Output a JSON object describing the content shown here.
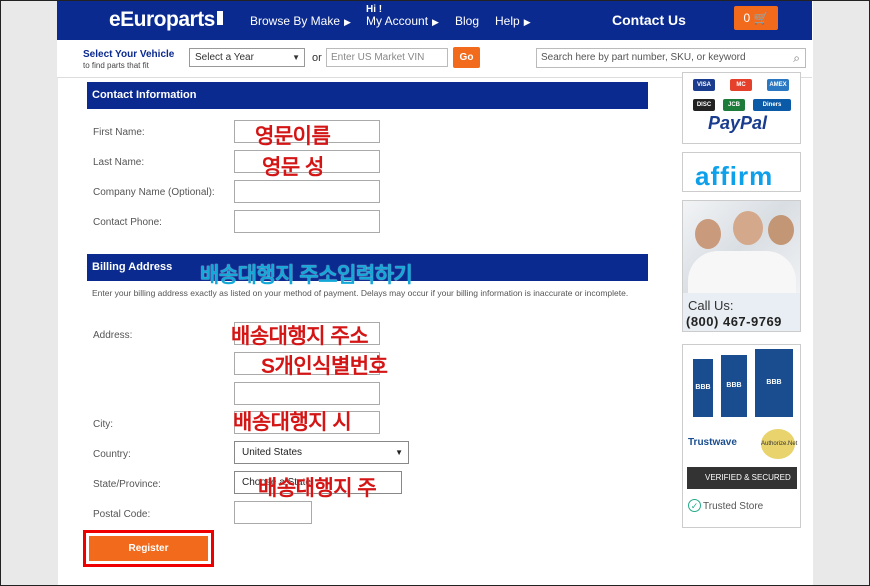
{
  "header": {
    "logo": "eEuroparts",
    "nav_browse": "Browse By Make",
    "nav_hi": "Hi !",
    "nav_account": "My Account",
    "nav_blog": "Blog",
    "nav_help": "Help",
    "contact": "Contact Us",
    "cart_count": "0"
  },
  "vehicle": {
    "title": "Select Your Vehicle",
    "subtitle": "to find parts that fit",
    "year_value": "Select a Year",
    "or": "or",
    "vin_placeholder": "Enter US Market VIN",
    "go": "Go",
    "search_placeholder": "Search here by part number, SKU, or keyword"
  },
  "contact_section": {
    "heading": "Contact Information",
    "first_name": "First Name:",
    "last_name": "Last Name:",
    "company": "Company Name (Optional):",
    "phone": "Contact Phone:"
  },
  "billing_section": {
    "heading": "Billing Address",
    "note": "Enter your billing address exactly as listed on your method of payment. Delays may occur if your billing information is inaccurate or incomplete.",
    "address": "Address:",
    "city": "City:",
    "country": "Country:",
    "country_value": "United States",
    "state": "State/Province:",
    "state_value": "Choose a State",
    "postal": "Postal Code:"
  },
  "register_label": "Register",
  "annotations": {
    "first_name": "영문이름",
    "last_name": "영문 성",
    "billing": "배송대행지 주소입력하기",
    "address1": "배송대행지 주소",
    "address2": "S개인식별번호",
    "city": "배송대행지 시",
    "state": "배송대행지 주"
  },
  "sidebar": {
    "cards": [
      "VISA",
      "MC",
      "AMEX",
      "DISC",
      "JCB",
      "Diners"
    ],
    "paypal": "PayPal",
    "affirm": "affirm",
    "call_us": "Call Us:",
    "phone": "(800) 467-9769",
    "bbb": "BBB",
    "trustwave": "Trustwave",
    "authorize": "Authorize.Net",
    "verified": "VERIFIED & SECURED",
    "trusted_store": "Trusted Store"
  },
  "colors": {
    "brand_blue": "#0b2a8f",
    "accent_orange": "#f26b1d",
    "annotation_red": "#d41515",
    "annotation_cyan": "#12a8d8"
  }
}
